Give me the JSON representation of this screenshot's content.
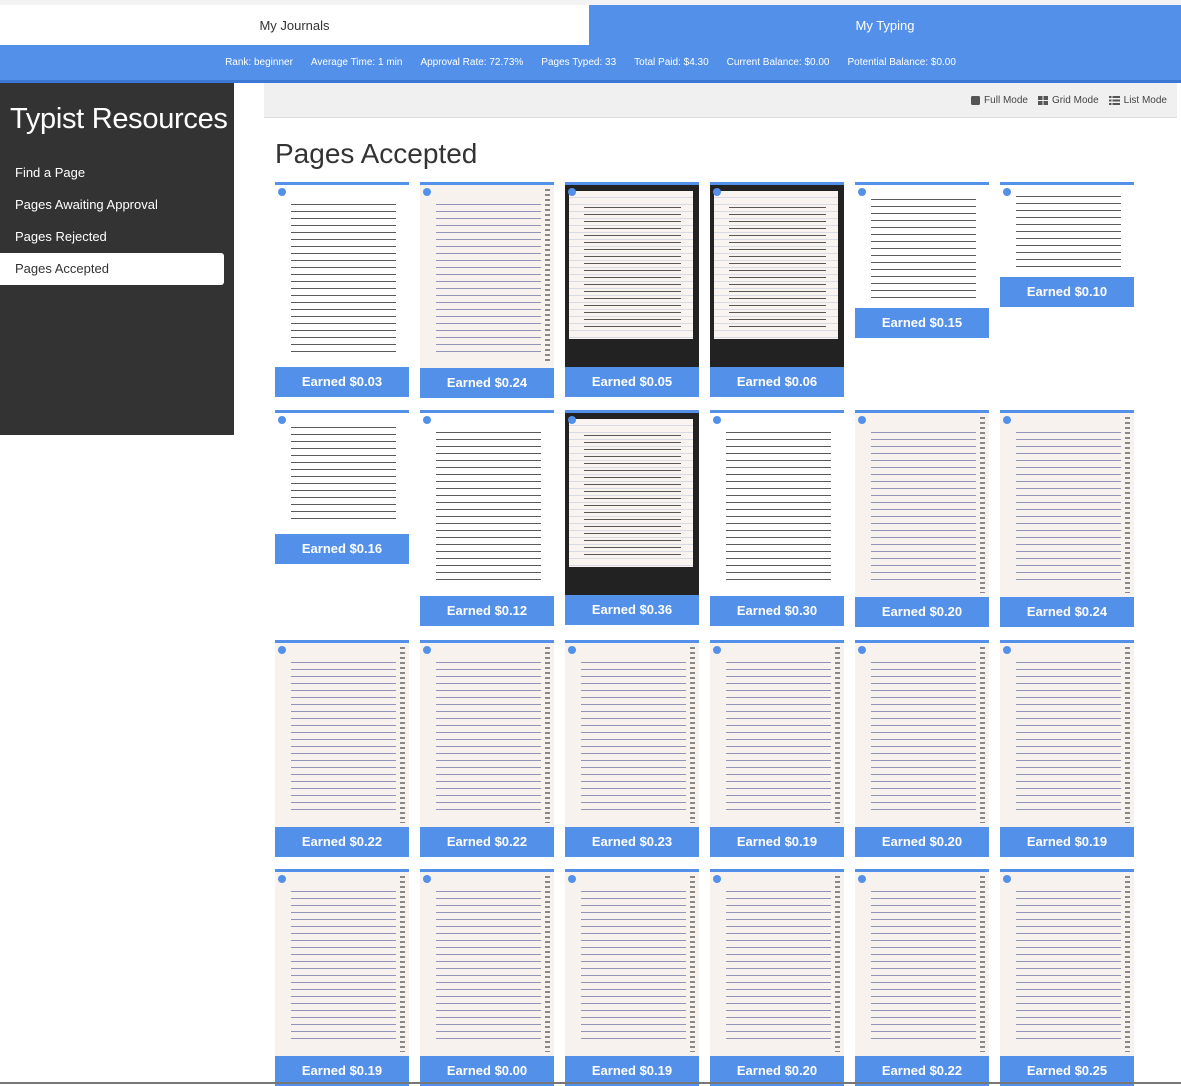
{
  "tabs": {
    "journals": "My Journals",
    "typing": "My Typing"
  },
  "stats": {
    "rank": "Rank: beginner",
    "avg_time": "Average Time: 1 min",
    "approval": "Approval Rate: 72.73%",
    "pages_typed": "Pages Typed: 33",
    "total_paid": "Total Paid: $4.30",
    "current_balance": "Current Balance: $0.00",
    "potential_balance": "Potential Balance: $0.00"
  },
  "sidebar": {
    "title": "Typist Resources",
    "items": [
      {
        "label": "Find a Page"
      },
      {
        "label": "Pages Awaiting Approval"
      },
      {
        "label": "Pages Rejected"
      },
      {
        "label": "Pages Accepted",
        "active": true
      }
    ]
  },
  "modes": {
    "full": "Full Mode",
    "grid": "Grid Mode",
    "list": "List Mode"
  },
  "page_title": "Pages Accepted",
  "cards": [
    {
      "earned": "Earned $0.03",
      "style": "white"
    },
    {
      "earned": "Earned $0.24",
      "style": "notebook"
    },
    {
      "earned": "Earned $0.05",
      "style": "dark"
    },
    {
      "earned": "Earned $0.06",
      "style": "dark"
    },
    {
      "earned": "Earned $0.15",
      "style": "white"
    },
    {
      "earned": "Earned $0.10",
      "style": "white"
    },
    {
      "earned": "Earned $0.16",
      "style": "white"
    },
    {
      "earned": "Earned $0.12",
      "style": "white"
    },
    {
      "earned": "Earned $0.36",
      "style": "dark"
    },
    {
      "earned": "Earned $0.30",
      "style": "white"
    },
    {
      "earned": "Earned $0.20",
      "style": "notebook"
    },
    {
      "earned": "Earned $0.24",
      "style": "notebook"
    },
    {
      "earned": "Earned $0.22",
      "style": "notebook"
    },
    {
      "earned": "Earned $0.22",
      "style": "notebook"
    },
    {
      "earned": "Earned $0.23",
      "style": "notebook"
    },
    {
      "earned": "Earned $0.19",
      "style": "notebook"
    },
    {
      "earned": "Earned $0.20",
      "style": "notebook"
    },
    {
      "earned": "Earned $0.19",
      "style": "notebook"
    },
    {
      "earned": "Earned $0.19",
      "style": "notebook"
    },
    {
      "earned": "Earned $0.00",
      "style": "notebook"
    },
    {
      "earned": "Earned $0.19",
      "style": "notebook"
    },
    {
      "earned": "Earned $0.20",
      "style": "notebook"
    },
    {
      "earned": "Earned $0.22",
      "style": "notebook"
    },
    {
      "earned": "Earned $0.25",
      "style": "notebook"
    }
  ],
  "colors": {
    "accent": "#5390ea",
    "sidebar": "#333333"
  }
}
